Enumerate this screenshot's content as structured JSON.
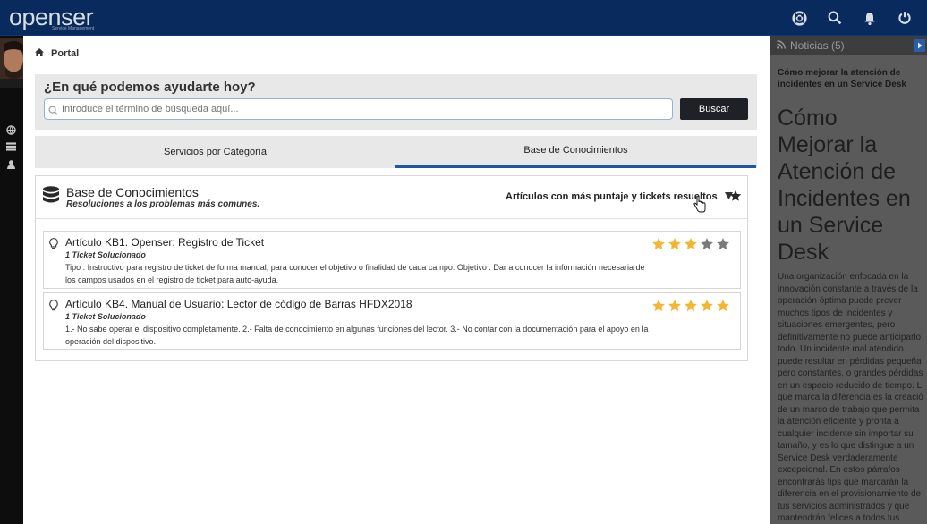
{
  "app": {
    "logo": "openser",
    "logo_tagline": "Service Management"
  },
  "header": {
    "icons": [
      "lifebuoy-icon",
      "search-icon",
      "bell-icon",
      "power-icon"
    ]
  },
  "sidebar": {
    "icons": [
      "globe-icon",
      "list-icon",
      "user-icon"
    ]
  },
  "breadcrumb": {
    "label": "Portal"
  },
  "search": {
    "title": "¿En qué podemos ayudarte hoy?",
    "placeholder": "Introduce el término de búsqueda aquí...",
    "button_label": "Buscar"
  },
  "tabs": [
    {
      "label": "Servicios por Categoría",
      "active": false
    },
    {
      "label": "Base de Conocimientos",
      "active": true
    }
  ],
  "kb": {
    "title": "Base de Conocimientos",
    "subtitle": "Resoluciones a los problemas más comunes.",
    "sort_label": "Artículos con más puntaje y tickets resueltos",
    "articles": [
      {
        "title": "Artículo KB1. Openser: Registro de Ticket",
        "tickets": "1 Ticket Solucionado",
        "description": "Tipo : Instructivo para registro de ticket de forma manual, para conocer el objetivo o finalidad de cada campo. Objetivo : Dar a conocer la información necesaria de los campos usados en el registro de ticket para auto-ayuda.",
        "rating": 3,
        "max_rating": 5
      },
      {
        "title": "Artículo KB4. Manual de Usuario: Lector de código de Barras HFDX2018",
        "tickets": "1 Ticket Solucionado",
        "description": "1.- No sabe operar el dispositivo completamente. 2.- Falta de conocimiento en algunas funciones del lector. 3.- No contar con la documentación para el apoyo en la operación del dispositivo.",
        "rating": 5,
        "max_rating": 5
      }
    ]
  },
  "news": {
    "title": "Noticias (5)",
    "link": "Cómo mejorar la atención de incidentes en un Service Desk",
    "big_lines": [
      "Cómo",
      "Mejorar la",
      "Atención de",
      "Incidentes en",
      "un Service",
      "Desk"
    ],
    "body_lines": [
      "Una organización enfocada en la",
      "innovación constante a través de la",
      "operación óptima puede prever",
      "muchos tipos de incidentes y",
      "situaciones emergentes, pero",
      "definitivamente no puede anticiparlo",
      "todo. Un incidente mal atendido",
      "puede resultar en pérdidas pequeña",
      "pero constantes, o grandes pérdidas",
      "en un espacio reducido de tiempo. L",
      "que marca la diferencia es la creació",
      "de un marco de trabajo que permita",
      "la atención eficiente y pronta a",
      "cualquier incidente sin importar su",
      "tamaño, y es lo que distingue a un",
      "Service Desk verdaderamente",
      "excepcional. En estos párrafos",
      "encontrarás tips que marcarán la",
      "diferencia en el provisionamiento de",
      "tus servicios administrados y que",
      "mantendrán felices a todos tus",
      "clientes, sean internos o externos"
    ]
  },
  "colors": {
    "header_bg": "#082a5c",
    "tab_active_underline": "#1d56a3",
    "star_filled": "#f2b632",
    "star_empty": "#7a7a7a",
    "button_bg": "#1e2226"
  }
}
